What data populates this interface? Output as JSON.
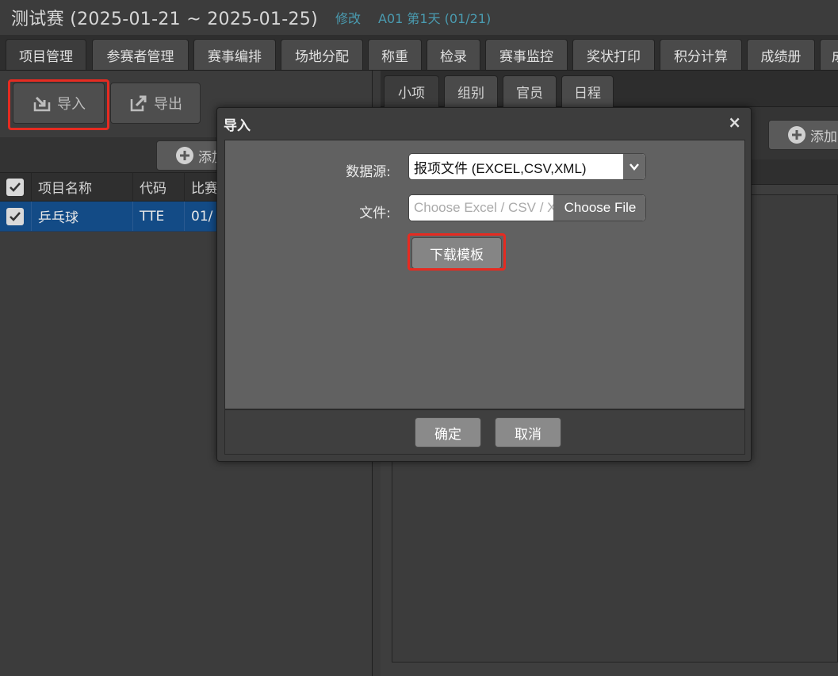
{
  "header": {
    "title": "测试赛 (2025-01-21 ~ 2025-01-25)",
    "edit_link": "修改",
    "day_info": "A01 第1天 (01/21)"
  },
  "main_tabs": [
    {
      "label": "项目管理",
      "active": true
    },
    {
      "label": "参赛者管理"
    },
    {
      "label": "赛事编排"
    },
    {
      "label": "场地分配"
    },
    {
      "label": "称重"
    },
    {
      "label": "检录"
    },
    {
      "label": "赛事监控"
    },
    {
      "label": "奖状打印"
    },
    {
      "label": "积分计算"
    },
    {
      "label": "成绩册"
    },
    {
      "label": "成"
    }
  ],
  "left_toolbar": {
    "import_label": "导入",
    "export_label": "导出",
    "add_label": "添加"
  },
  "left_grid": {
    "columns": [
      "项目名称",
      "代码",
      "比赛"
    ],
    "rows": [
      {
        "name": "乒乓球",
        "code": "TTE",
        "date": "01/"
      }
    ]
  },
  "sub_tabs": [
    {
      "label": "小项",
      "active": true
    },
    {
      "label": "组别"
    },
    {
      "label": "官员"
    },
    {
      "label": "日程"
    }
  ],
  "right_toolbar": {
    "add_label": "添加"
  },
  "dialog": {
    "title": "导入",
    "close": "×",
    "source_label": "数据源:",
    "source_value": "报项文件 (EXCEL,CSV,XML)",
    "file_label": "文件:",
    "file_placeholder": "Choose Excel / CSV / XML",
    "choose_file": "Choose File",
    "download_template": "下载模板",
    "ok": "确定",
    "cancel": "取消"
  },
  "highlight_color": "#e62b21",
  "selected_row_color": "#134b86",
  "accent_link_color": "#4a9bb0"
}
